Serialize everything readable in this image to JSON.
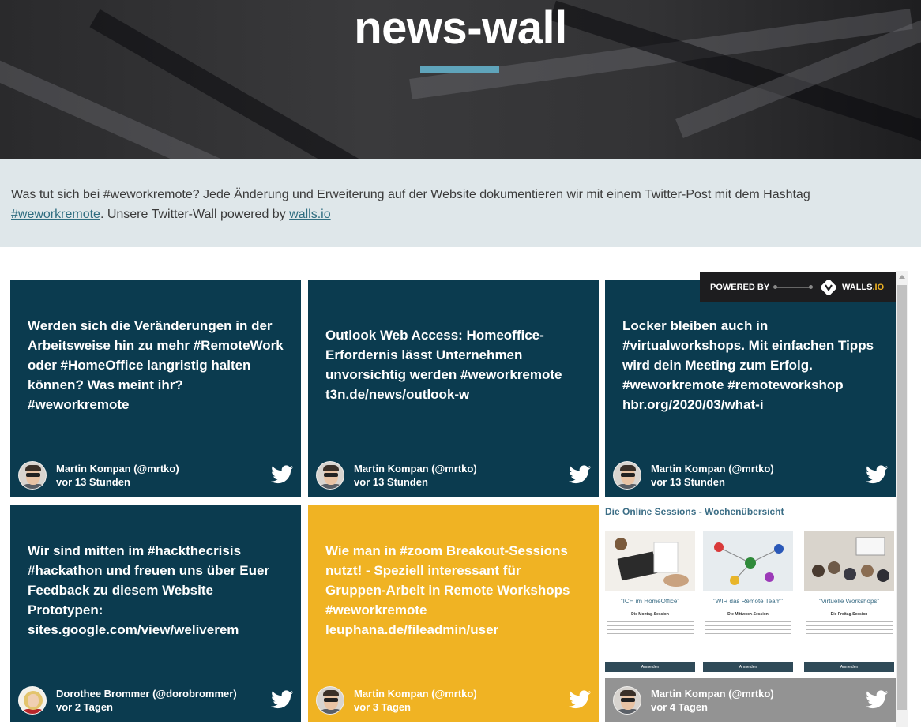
{
  "header": {
    "title": "news-wall"
  },
  "intro": {
    "text_before_hashtag": "Was tut sich bei #weworkremote? Jede Änderung und Erweiterung auf der Website dokumentieren wir mit einem Twitter-Post mit dem Hashtag",
    "hashtag_link": "#weworkremote",
    "text_middle": ". Unsere Twitter-Wall powered by ",
    "walls_link": "walls.io"
  },
  "powered_badge": {
    "label": "POWERED BY",
    "brand_main": "WALLS",
    "brand_suffix": ".IO"
  },
  "colors": {
    "card_dark": "#0b3b4f",
    "card_highlight": "#f0b323",
    "accent_line": "#5fa4bb",
    "intro_bg": "#dfe7ea"
  },
  "posts": [
    {
      "text": "Werden sich die Veränderungen in der Arbeitsweise hin zu mehr #RemoteWork oder #HomeOffice langristig halten können? Was meint ihr? #weworkremote",
      "author": "Martin Kompan (@mrtko)",
      "time": "vor 13 Stunden",
      "icon": "twitter-icon"
    },
    {
      "text": "Outlook Web Access: Homeoffice-Erfordernis lässt Unternehmen unvorsichtig werden #weworkremote t3n.de/news/outlook-w",
      "author": "Martin Kompan (@mrtko)",
      "time": "vor 13 Stunden",
      "icon": "twitter-icon"
    },
    {
      "text": "Locker bleiben auch in #virtualworkshops. Mit einfachen Tipps wird dein Meeting zum Erfolg. #weworkremote #remoteworkshop hbr.org/2020/03/what-i",
      "author": "Martin Kompan (@mrtko)",
      "time": "vor 13 Stunden",
      "icon": "twitter-icon"
    },
    {
      "text": "Wir sind mitten im #hackthecrisis #hackathon und freuen uns über Euer Feedback zu diesem Website Prototypen: sites.google.com/view/weliverem",
      "author": "Dorothee Brommer (@dorobrommer)",
      "time": "vor 2 Tagen",
      "icon": "twitter-icon"
    },
    {
      "text": "Wie man in #zoom Breakout-Sessions nutzt! - Speziell interessant für Gruppen-Arbeit in Remote Workshops #weworkremote leuphana.de/fileadmin/user",
      "author": "Martin Kompan (@mrtko)",
      "time": "vor 3 Tagen",
      "icon": "twitter-icon"
    },
    {
      "author": "Martin Kompan (@mrtko)",
      "time": "vor 4 Tagen",
      "icon": "twitter-icon",
      "image": {
        "heading": "Die Online Sessions - Wochenübersicht",
        "columns": [
          {
            "title": "\"ICH im HomeOffice\"",
            "subtitle": "Die Montag-Session",
            "button": "Anmelden"
          },
          {
            "title": "\"WIR das Remote Team\"",
            "subtitle": "Die Mittwoch-Session",
            "button": "Anmelden"
          },
          {
            "title": "\"Virtuelle Workshops\"",
            "subtitle": "Die Freitag-Session",
            "button": "Anmelden"
          }
        ]
      }
    }
  ]
}
